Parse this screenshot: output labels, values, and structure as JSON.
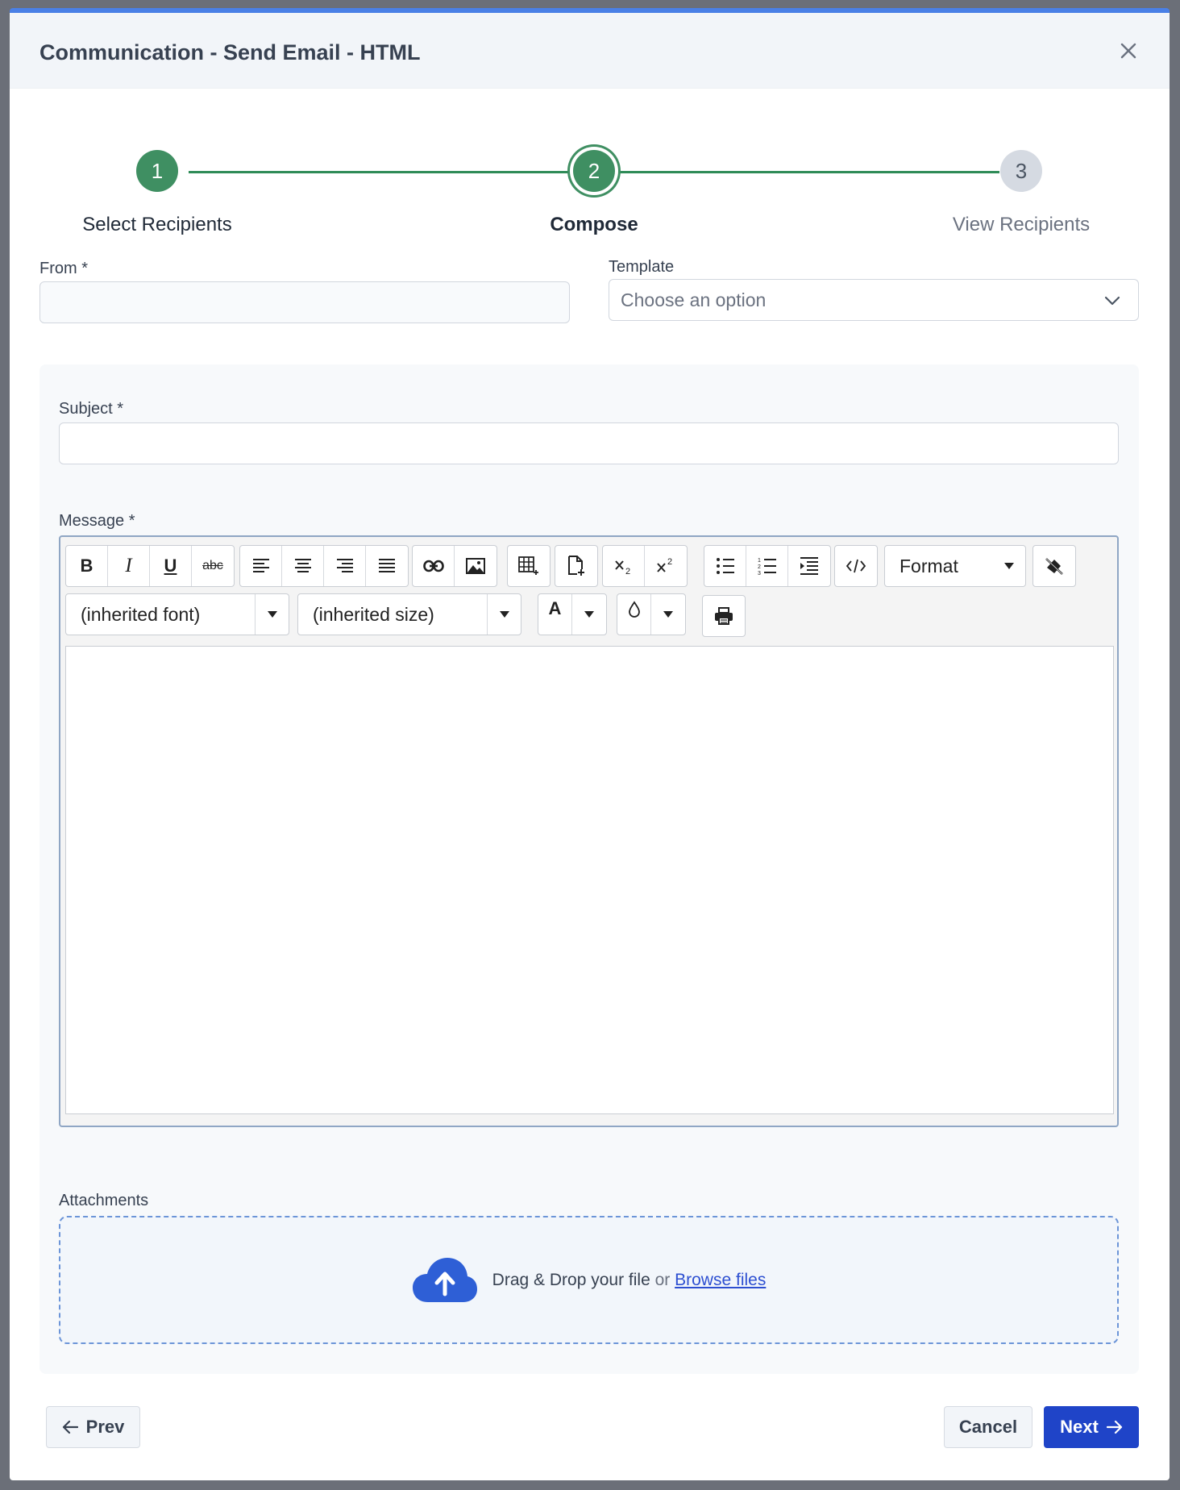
{
  "modal": {
    "title": "Communication - Send Email - HTML"
  },
  "stepper": {
    "steps": [
      {
        "number": "1",
        "label": "Select Recipients",
        "state": "done"
      },
      {
        "number": "2",
        "label": "Compose",
        "state": "active"
      },
      {
        "number": "3",
        "label": "View Recipients",
        "state": "pending"
      }
    ]
  },
  "form": {
    "from_label": "From *",
    "from_value": "",
    "template_label": "Template",
    "template_placeholder": "Choose an option",
    "subject_label": "Subject *",
    "subject_value": "",
    "message_label": "Message *",
    "attachments_label": "Attachments"
  },
  "editor": {
    "format_label": "Format",
    "font_label": "(inherited font)",
    "size_label": "(inherited size)",
    "bold": "B",
    "italic": "I",
    "underline": "U",
    "strike": "abc",
    "font_color_glyph": "A"
  },
  "dropzone": {
    "text": "Drag & Drop your file",
    "or": "or",
    "link": "Browse files"
  },
  "footer": {
    "prev_label": "Prev",
    "cancel_label": "Cancel",
    "next_label": "Next"
  },
  "colors": {
    "accent": "#1f44c8",
    "step_green": "#3f8f62",
    "header_bar": "#4a80e6"
  }
}
